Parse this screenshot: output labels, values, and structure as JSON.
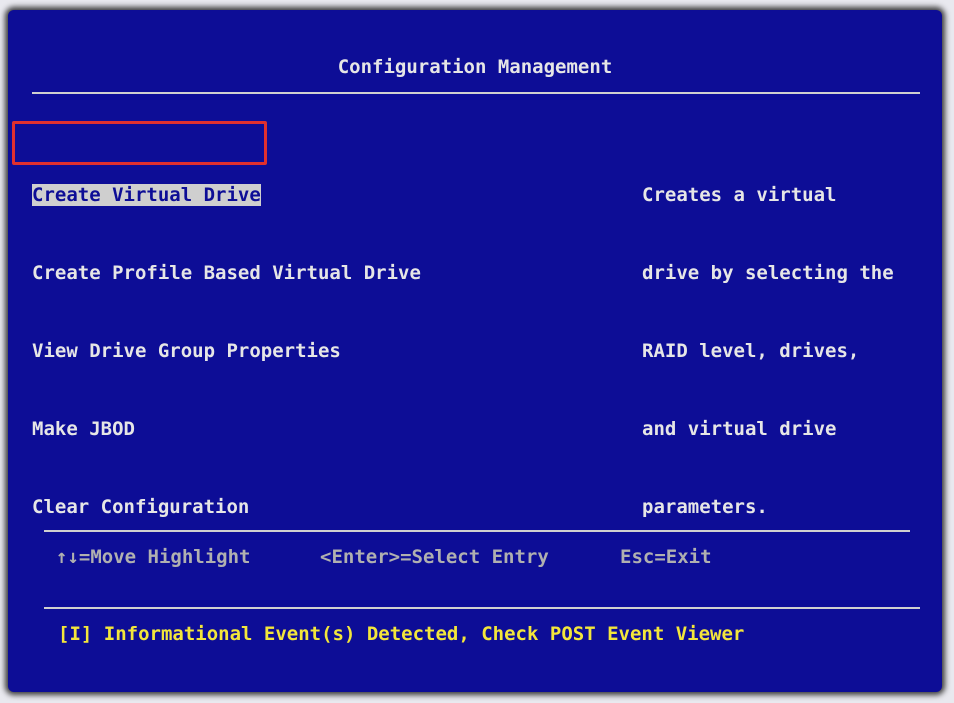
{
  "title": "Configuration Management",
  "menu": {
    "items": [
      "Create Virtual Drive",
      "Create Profile Based Virtual Drive",
      "View Drive Group Properties",
      "Make JBOD",
      "Clear Configuration"
    ],
    "selected_index": 0
  },
  "help": {
    "lines": [
      "Creates a virtual",
      "drive by selecting the",
      "RAID level, drives,",
      "and virtual drive",
      "parameters."
    ]
  },
  "keys": {
    "move": "↑↓=Move Highlight",
    "enter": "<Enter>=Select Entry",
    "exit": "Esc=Exit"
  },
  "status": "[I] Informational Event(s) Detected, Check POST Event Viewer",
  "colors": {
    "background": "#0d0d96",
    "text": "#e6e6e6",
    "status_text": "#f3e63b",
    "annotation_box": "#e0302e"
  }
}
